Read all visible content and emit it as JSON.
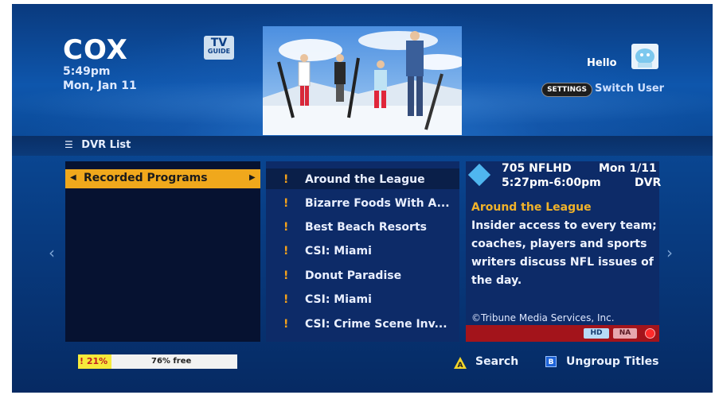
{
  "header": {
    "brand": "COX",
    "time": "5:49pm",
    "date": "Mon, Jan 11",
    "tv_guide_top": "TV",
    "tv_guide_bottom": "GUIDE",
    "greeting": "Hello",
    "settings_label": "SETTINGS",
    "switch_user_label": "Switch User"
  },
  "section": {
    "title": "DVR List"
  },
  "menu": {
    "selected": "Recorded Programs"
  },
  "programs": [
    {
      "title": "Around the League",
      "flag": "!"
    },
    {
      "title": "Bizarre Foods With A...",
      "flag": "!"
    },
    {
      "title": "Best Beach Resorts",
      "flag": "!"
    },
    {
      "title": "CSI: Miami",
      "flag": "!"
    },
    {
      "title": "Donut Paradise",
      "flag": "!"
    },
    {
      "title": "CSI: Miami",
      "flag": "!"
    },
    {
      "title": "CSI: Crime Scene Inv...",
      "flag": "!"
    }
  ],
  "details": {
    "channel": "705 NFLHD",
    "day": "Mon 1/11",
    "time": "5:27pm-6:00pm",
    "source": "DVR",
    "title": "Around the League",
    "description": "Insider access to every team; coaches, players and sports writers discuss NFL issues of the day.",
    "copyright": "©Tribune Media Services, Inc.",
    "badge_hd": "HD",
    "badge_na": "NA"
  },
  "footer": {
    "used_label": "21%",
    "used_fraction": 0.21,
    "free_label": "76% free",
    "search_label": "Search",
    "ungroup_label": "Ungroup Titles",
    "a_key": "A",
    "b_key": "B"
  },
  "colors": {
    "accent": "#f0a81c",
    "selected_row": "#0a1f49",
    "record": "#ff2a2a"
  }
}
